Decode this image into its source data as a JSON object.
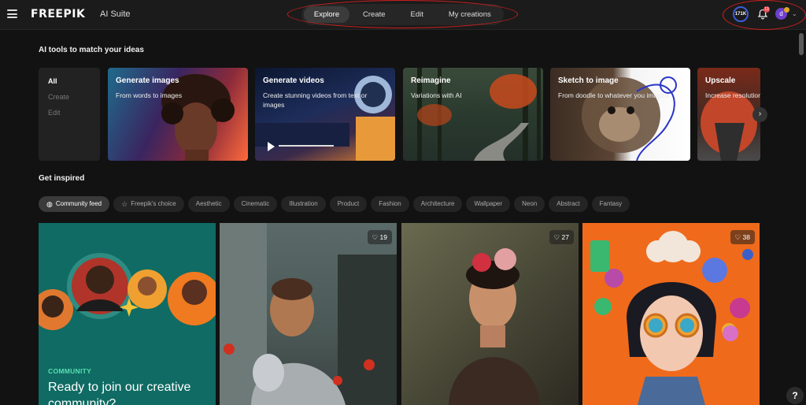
{
  "header": {
    "logo": "FREEPIK",
    "suite": "AI Suite",
    "nav": [
      {
        "label": "Explore",
        "active": true
      },
      {
        "label": "Create",
        "active": false
      },
      {
        "label": "Edit",
        "active": false
      },
      {
        "label": "My creations",
        "active": false
      }
    ],
    "credits": "171K",
    "notifications": "13",
    "user_initial": "d"
  },
  "tools": {
    "heading": "AI tools to match your ideas",
    "filters": [
      "All",
      "Create",
      "Edit"
    ],
    "cards": [
      {
        "title": "Generate images",
        "subtitle": "From words to images"
      },
      {
        "title": "Generate videos",
        "subtitle": "Create stunning videos from text or images"
      },
      {
        "title": "Reimagine",
        "subtitle": "Variations with AI"
      },
      {
        "title": "Sketch to image",
        "subtitle": "From doodle to whatever you imagine"
      },
      {
        "title": "Upscale",
        "subtitle": "Increase resolution"
      }
    ]
  },
  "inspired": {
    "heading": "Get inspired",
    "chips": [
      "Community feed",
      "Freepik's choice",
      "Aesthetic",
      "Cinematic",
      "Illustration",
      "Product",
      "Fashion",
      "Architecture",
      "Wallpaper",
      "Neon",
      "Abstract",
      "Fantasy"
    ],
    "community": {
      "eyebrow": "COMMUNITY",
      "headline": "Ready to join our creative community?"
    },
    "likes": [
      "19",
      "27",
      "38"
    ]
  },
  "colors": {
    "accent": "#3d5bd6",
    "community_bg": "#0f6b63",
    "community_accent": "#58e0b0",
    "annotation": "#d21f1f"
  }
}
